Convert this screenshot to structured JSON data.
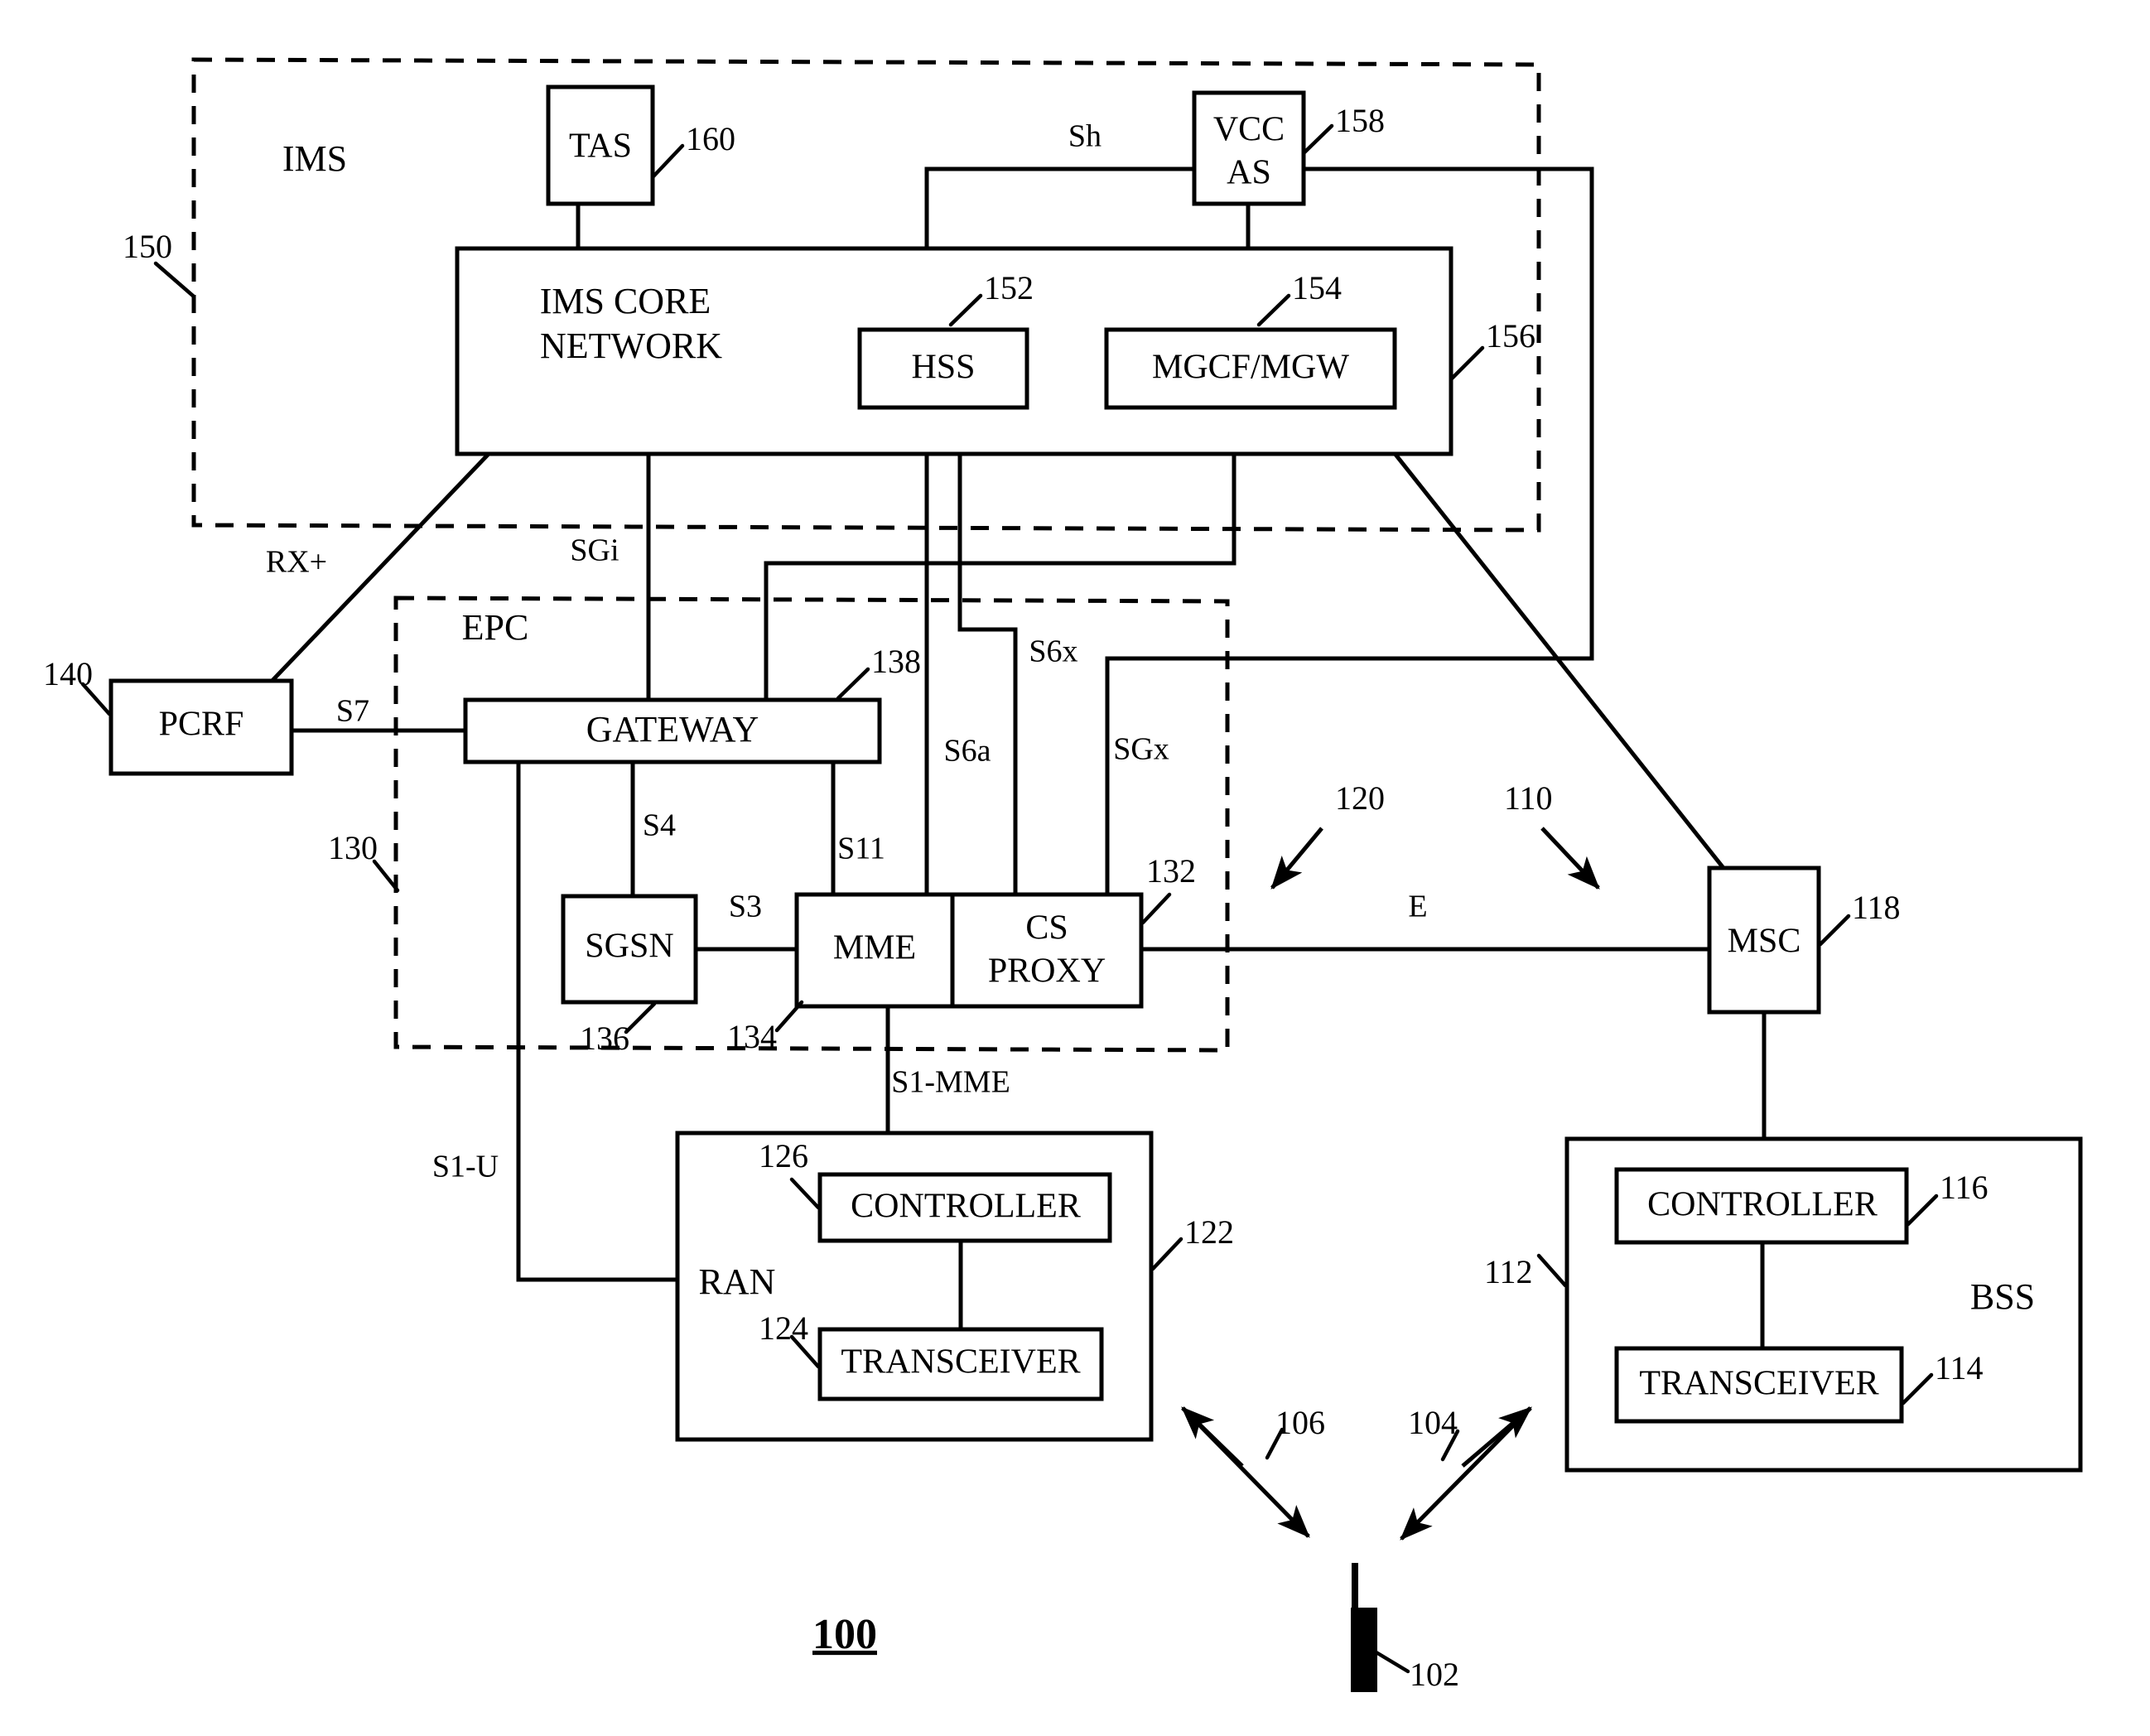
{
  "figure": {
    "number": "100",
    "title_ref": "100"
  },
  "regions": [
    {
      "id": "ims",
      "label": "IMS",
      "ref": "150"
    },
    {
      "id": "epc",
      "label": "EPC",
      "ref": "130"
    }
  ],
  "boxes": [
    {
      "id": "tas",
      "label": "TAS",
      "ref": "160"
    },
    {
      "id": "vcc_as",
      "label_line1": "VCC",
      "label_line2": "AS",
      "ref": "158"
    },
    {
      "id": "ims_core",
      "label_line1": "IMS CORE",
      "label_line2": "NETWORK",
      "ref": "156"
    },
    {
      "id": "hss",
      "label": "HSS",
      "ref": "152"
    },
    {
      "id": "mgcf_mgw",
      "label": "MGCF/MGW",
      "ref": "154"
    },
    {
      "id": "pcrf",
      "label": "PCRF",
      "ref": "140"
    },
    {
      "id": "gateway",
      "label": "GATEWAY",
      "ref": "138"
    },
    {
      "id": "sgsn",
      "label": "SGSN",
      "ref": "136"
    },
    {
      "id": "mme",
      "label": "MME",
      "ref": "134"
    },
    {
      "id": "cs_proxy",
      "label_line1": "CS",
      "label_line2": "PROXY",
      "ref": "132"
    },
    {
      "id": "msc",
      "label": "MSC",
      "ref": "118"
    },
    {
      "id": "ran",
      "label": "RAN",
      "ref": "122"
    },
    {
      "id": "ran_controller",
      "label": "CONTROLLER",
      "ref": "126"
    },
    {
      "id": "ran_transceiver",
      "label": "TRANSCEIVER",
      "ref": "124"
    },
    {
      "id": "bss",
      "label": "BSS",
      "ref": "112"
    },
    {
      "id": "bss_controller",
      "label": "CONTROLLER",
      "ref": "116"
    },
    {
      "id": "bss_transceiver",
      "label": "TRANSCEIVER",
      "ref": "114"
    }
  ],
  "interfaces": [
    {
      "id": "sh",
      "label": "Sh"
    },
    {
      "id": "rx",
      "label": "RX+"
    },
    {
      "id": "sgi",
      "label": "SGi"
    },
    {
      "id": "s7",
      "label": "S7"
    },
    {
      "id": "s4",
      "label": "S4"
    },
    {
      "id": "s3",
      "label": "S3"
    },
    {
      "id": "s11",
      "label": "S11"
    },
    {
      "id": "s6a",
      "label": "S6a"
    },
    {
      "id": "s6x",
      "label": "S6x"
    },
    {
      "id": "sgx",
      "label": "SGx"
    },
    {
      "id": "s1_mme",
      "label": "S1-MME"
    },
    {
      "id": "s1_u",
      "label": "S1-U"
    },
    {
      "id": "e",
      "label": "E"
    }
  ],
  "arrow_refs": [
    {
      "id": "ref120",
      "label": "120"
    },
    {
      "id": "ref110",
      "label": "110"
    },
    {
      "id": "ref106",
      "label": "106"
    },
    {
      "id": "ref104",
      "label": "104"
    }
  ],
  "device": {
    "id": "ue",
    "ref": "102"
  },
  "colors": {
    "ink": "#000000",
    "paper": "#ffffff"
  }
}
